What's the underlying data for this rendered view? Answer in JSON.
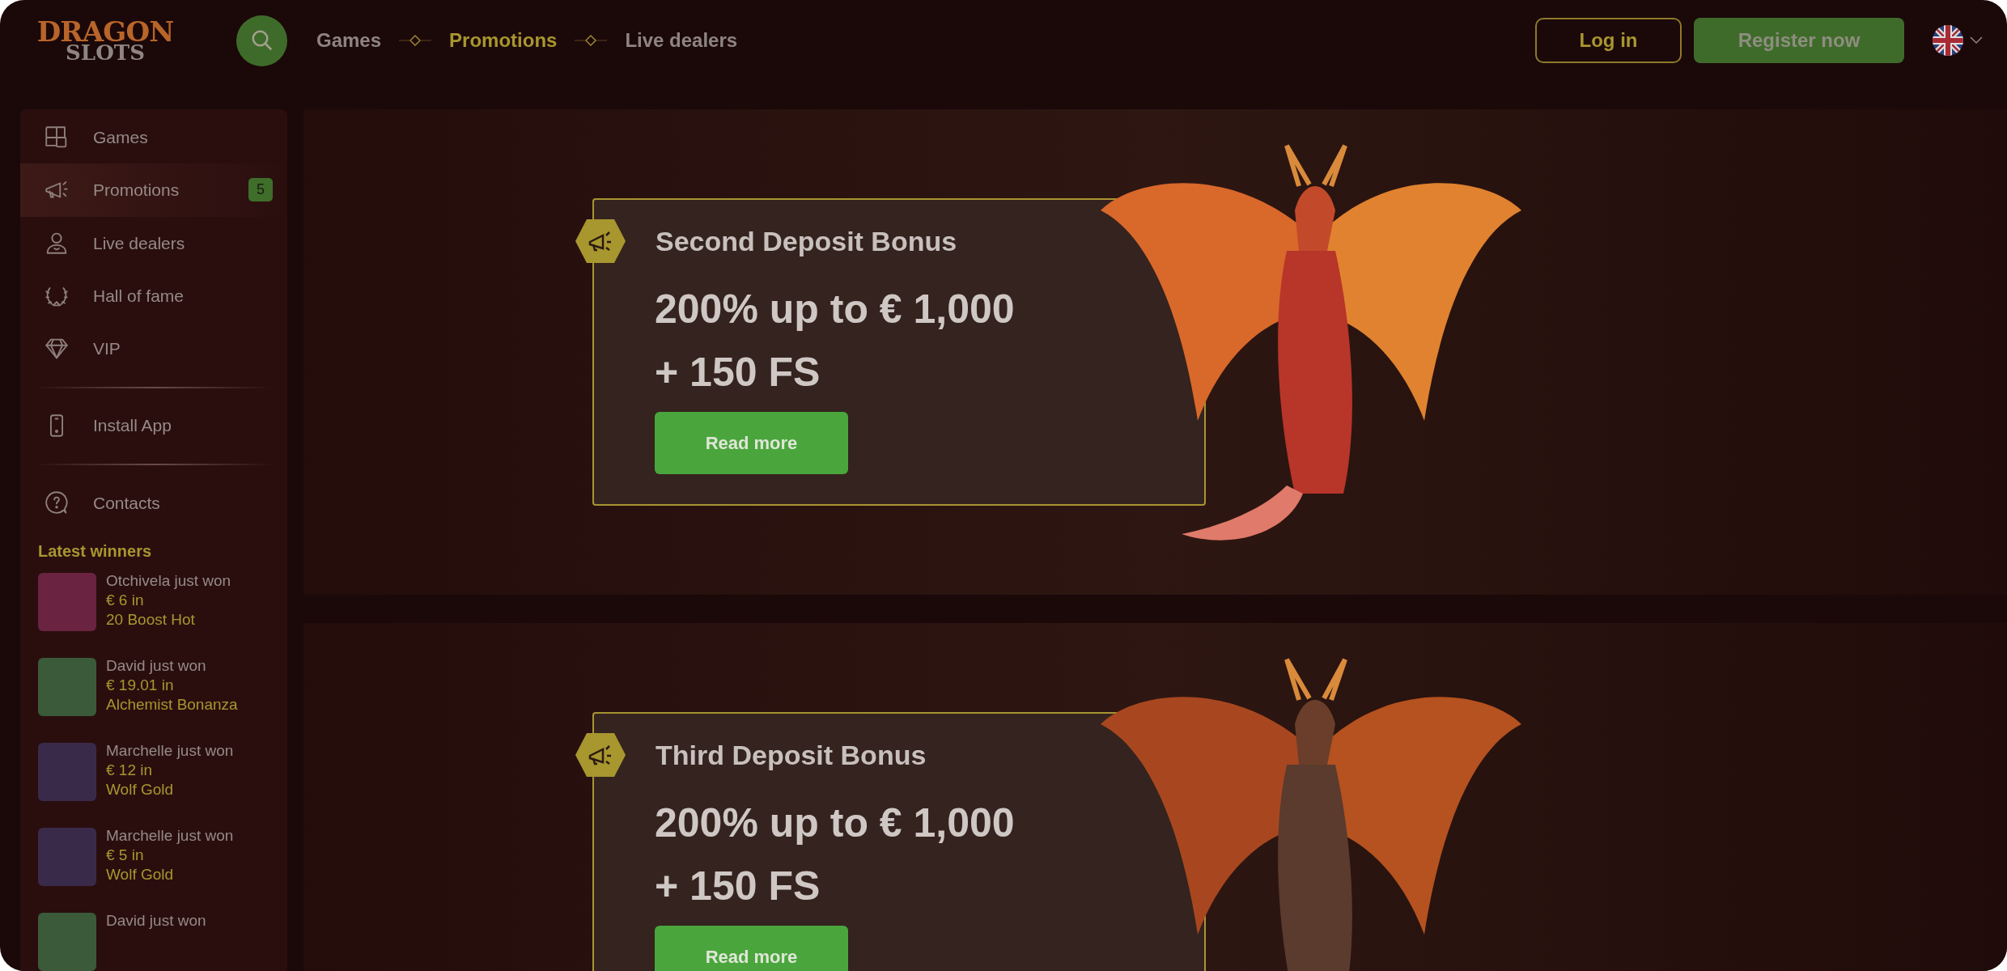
{
  "header": {
    "logo": {
      "line_1": "DRAGON",
      "line_2": "SLOTS"
    },
    "nav": [
      {
        "label": "Games",
        "selected": false
      },
      {
        "label": "Promotions",
        "selected": true
      },
      {
        "label": "Live dealers",
        "selected": false
      }
    ],
    "login": "Log in",
    "register": "Register now"
  },
  "sidebar": {
    "groups": [
      [
        {
          "label": "Games",
          "selected": false
        },
        {
          "label": "Promotions",
          "selected": true,
          "badge": "5"
        },
        {
          "label": "Live dealers",
          "selected": false
        },
        {
          "label": "Hall of fame",
          "selected": false
        },
        {
          "label": "VIP",
          "selected": false
        }
      ],
      [
        {
          "label": "Install App",
          "selected": false
        }
      ],
      [
        {
          "label": "Contacts",
          "selected": false
        }
      ]
    ],
    "winners_title": "Latest winners",
    "winners": [
      {
        "player": "Otchivela just won",
        "amount": "€ 6 in",
        "game": "20 Boost Hot"
      },
      {
        "player": "David just won",
        "amount": "€ 19.01 in",
        "game": "Alchemist Bonanza"
      },
      {
        "player": "Marchelle just won",
        "amount": "€ 12 in",
        "game": "Wolf Gold"
      },
      {
        "player": "Marchelle just won",
        "amount": "€ 5 in",
        "game": "Wolf Gold"
      },
      {
        "player": "David just won"
      }
    ]
  },
  "promotions": [
    {
      "title": "Second Deposit Bonus",
      "offer_line_1": "200% up to € 1,000",
      "offer_line_2": "+ 150 FS",
      "button": "Read more"
    },
    {
      "title": "Third Deposit Bonus",
      "offer_line_1": "200% up to € 1,000",
      "offer_line_2": "+ 150 FS",
      "button": "Read more"
    }
  ]
}
